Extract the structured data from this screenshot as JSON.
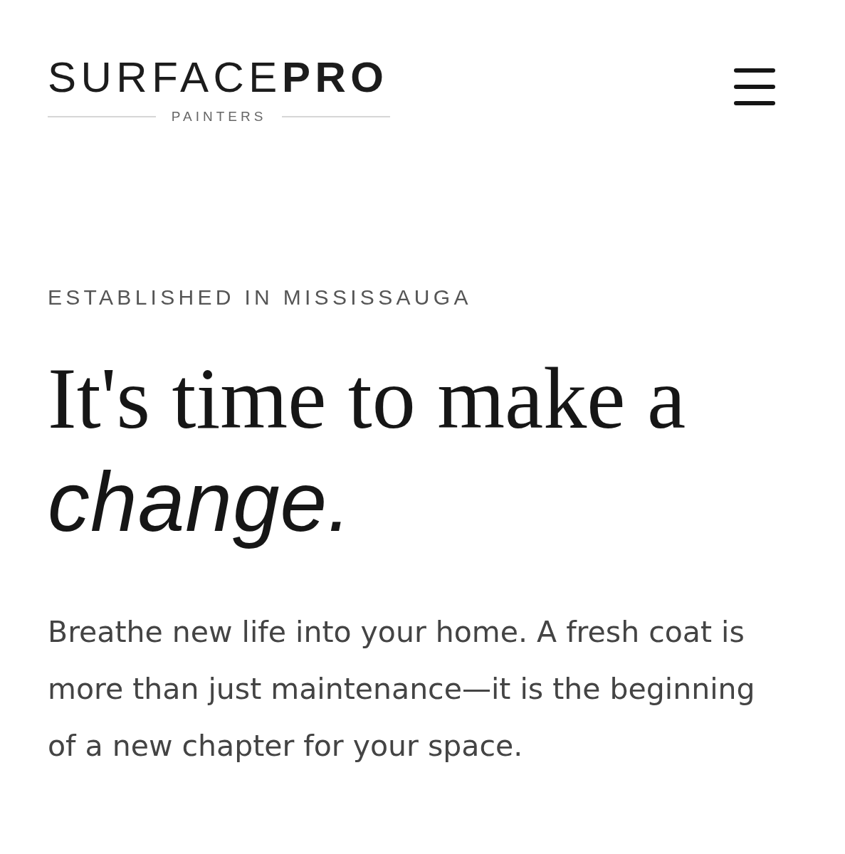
{
  "header": {
    "logo": {
      "wordmark": "SURFACE**PRO**",
      "tagline": "PAINTERS"
    }
  },
  "hero": {
    "eyebrow": "ESTABLISHED IN MISSISSAUGA",
    "heading": "It's time to make a *change.*",
    "body": "Breathe new life into your home. A fresh coat is more than just maintenance—it is the beginning of a new chapter for your space."
  }
}
